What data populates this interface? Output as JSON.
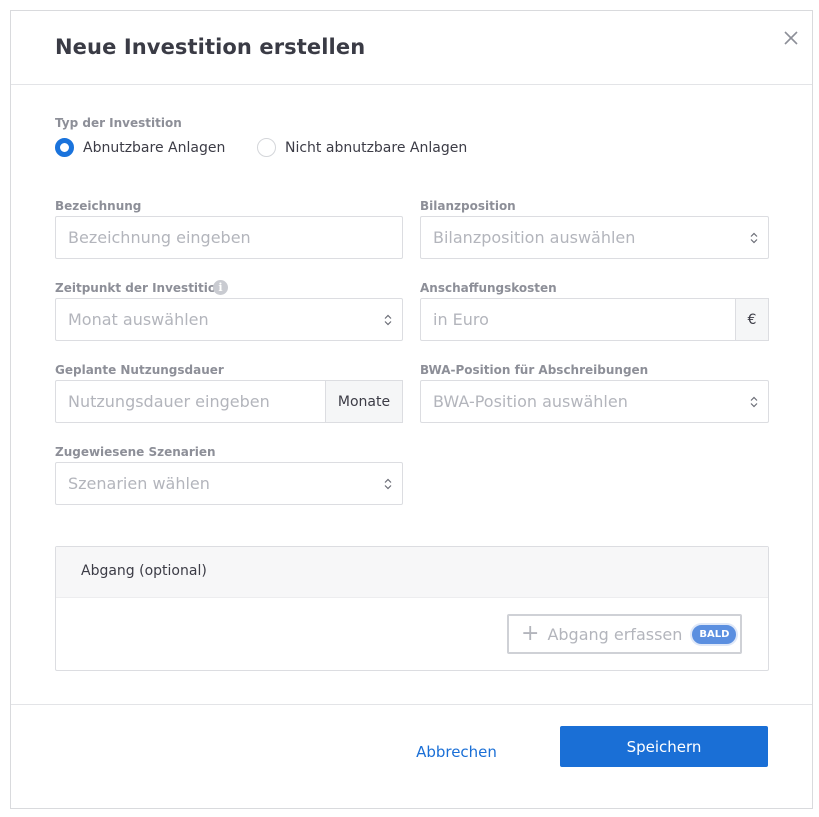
{
  "dialog": {
    "title": "Neue Investition erstellen"
  },
  "type": {
    "label": "Typ der Investition",
    "options": [
      {
        "label": "Abnutzbare Anlagen",
        "selected": true
      },
      {
        "label": "Nicht abnutzbare Anlagen",
        "selected": false
      }
    ]
  },
  "fields": {
    "bezeichnung": {
      "label": "Bezeichnung",
      "placeholder": "Bezeichnung eingeben"
    },
    "bilanzposition": {
      "label": "Bilanzposition",
      "placeholder": "Bilanzposition auswählen"
    },
    "zeitpunkt": {
      "label": "Zeitpunkt der Investition",
      "placeholder": "Monat auswählen",
      "info": "i"
    },
    "anschaffungskosten": {
      "label": "Anschaffungskosten",
      "placeholder": "in Euro",
      "unit": "€"
    },
    "nutzungsdauer": {
      "label": "Geplante Nutzungsdauer",
      "placeholder": "Nutzungsdauer eingeben",
      "unit": "Monate"
    },
    "bwa": {
      "label": "BWA-Position für Abschreibungen",
      "placeholder": "BWA-Position auswählen"
    },
    "szenarien": {
      "label": "Zugewiesene Szenarien",
      "placeholder": "Szenarien wählen"
    }
  },
  "abgang": {
    "title": "Abgang (optional)",
    "button_label": "Abgang erfassen",
    "button_icon": "plus-icon",
    "badge": "BALD"
  },
  "footer": {
    "cancel_label": "Abbrechen",
    "save_label": "Speichern"
  },
  "colors": {
    "primary": "#1a6fd6",
    "badge": "#5b8fe0"
  }
}
